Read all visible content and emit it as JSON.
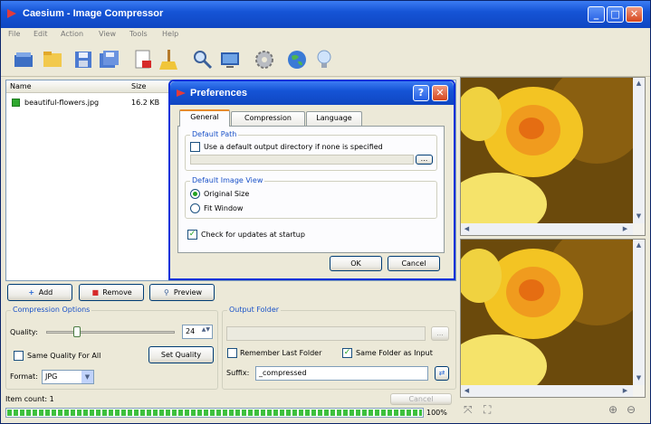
{
  "window": {
    "title": "Caesium - Image Compressor",
    "min_glyph": "_",
    "max_glyph": "□",
    "close_glyph": "✕"
  },
  "menu": [
    "File",
    "Edit",
    "Action",
    "View",
    "Tools",
    "Help"
  ],
  "toolbar_icons": [
    "open-folder-icon",
    "open-file-icon",
    "save-icon",
    "save-all-icon",
    "remove-icon",
    "clear-list-icon",
    "search-icon",
    "preview-icon",
    "settings-icon",
    "web-icon",
    "tip-icon"
  ],
  "file_list": {
    "columns": [
      "Name",
      "Size"
    ],
    "rows": [
      {
        "name": "beautiful-flowers.jpg",
        "size": "16.2 KB"
      }
    ]
  },
  "buttons": {
    "add": "Add",
    "remove": "Remove",
    "preview": "Preview",
    "set_quality": "Set Quality",
    "cancel": "Cancel"
  },
  "compression": {
    "title": "Compression Options",
    "quality_label": "Quality:",
    "quality_value": "24",
    "quality_fraction": 0.24,
    "same_quality_label": "Same Quality For All",
    "format_label": "Format:",
    "format_value": "JPG"
  },
  "output": {
    "title": "Output Folder",
    "path_value": "",
    "browse_label": "...",
    "remember_label": "Remember Last Folder",
    "remember_checked": false,
    "same_folder_label": "Same Folder as Input",
    "same_folder_checked": true,
    "suffix_label": "Suffix:",
    "suffix_value": "_compressed"
  },
  "status": {
    "item_count": "Item count: 1",
    "progress_percent": 100,
    "progress_label": "100%"
  },
  "preferences": {
    "title": "Preferences",
    "help_glyph": "?",
    "close_glyph": "✕",
    "tabs": [
      "General",
      "Compression",
      "Language"
    ],
    "default_path": {
      "title": "Default Path",
      "checkbox_label": "Use a default output directory if none is specified",
      "browse_label": "..."
    },
    "default_view": {
      "title": "Default Image View",
      "original_label": "Original Size",
      "fit_label": "Fit Window"
    },
    "check_updates_label": "Check for updates at startup",
    "ok_label": "OK",
    "cancel_label": "Cancel"
  },
  "colors": {
    "titlebar": "#1554d6",
    "accent": "#1a52c8",
    "check_green": "#21a121"
  }
}
